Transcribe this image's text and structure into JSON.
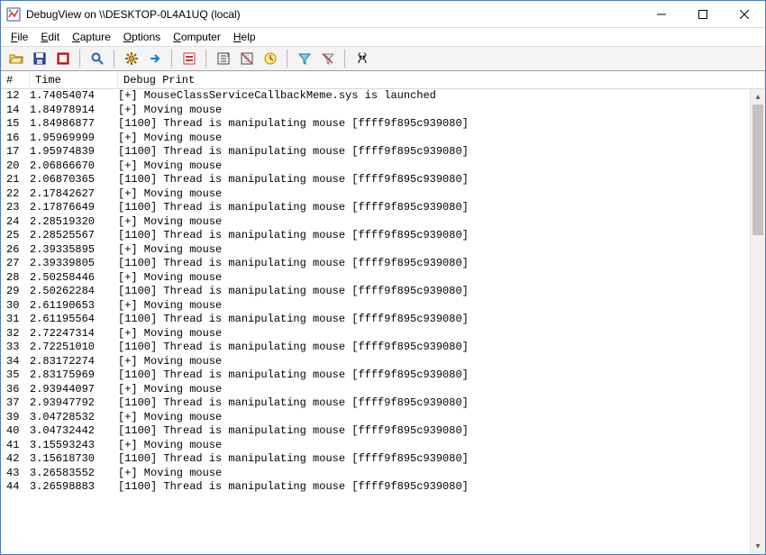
{
  "window": {
    "title": "DebugView on \\\\DESKTOP-0L4A1UQ (local)"
  },
  "menu": {
    "items": [
      {
        "label": "File",
        "mn": "F"
      },
      {
        "label": "Edit",
        "mn": "E"
      },
      {
        "label": "Capture",
        "mn": "C"
      },
      {
        "label": "Options",
        "mn": "O"
      },
      {
        "label": "Computer",
        "mn": "C"
      },
      {
        "label": "Help",
        "mn": "H"
      }
    ]
  },
  "toolbar": {
    "buttons": [
      {
        "name": "open-icon"
      },
      {
        "name": "save-icon"
      },
      {
        "name": "capture-toggle-icon"
      },
      {
        "sep": true
      },
      {
        "name": "magnifier-icon"
      },
      {
        "sep": true
      },
      {
        "name": "gear-icon"
      },
      {
        "name": "arrow-right-icon"
      },
      {
        "sep": true
      },
      {
        "name": "highlight-icon"
      },
      {
        "sep": true
      },
      {
        "name": "autoscroll-icon"
      },
      {
        "name": "clear-icon"
      },
      {
        "name": "clock-icon"
      },
      {
        "sep": true
      },
      {
        "name": "filter-include-icon"
      },
      {
        "name": "filter-exclude-icon"
      },
      {
        "sep": true
      },
      {
        "name": "find-icon"
      }
    ]
  },
  "columns": {
    "num": "#",
    "time": "Time",
    "msg": "Debug Print"
  },
  "rows": [
    {
      "n": "12",
      "t": "1.74054074",
      "m": "[+] MouseClassServiceCallbackMeme.sys is launched"
    },
    {
      "n": "14",
      "t": "1.84978914",
      "m": "[+] Moving mouse"
    },
    {
      "n": "15",
      "t": "1.84986877",
      "m": "[1100] Thread is manipulating mouse [ffff9f895c939080]"
    },
    {
      "n": "16",
      "t": "1.95969999",
      "m": "[+] Moving mouse"
    },
    {
      "n": "17",
      "t": "1.95974839",
      "m": "[1100] Thread is manipulating mouse [ffff9f895c939080]"
    },
    {
      "n": "20",
      "t": "2.06866670",
      "m": "[+] Moving mouse"
    },
    {
      "n": "21",
      "t": "2.06870365",
      "m": "[1100] Thread is manipulating mouse [ffff9f895c939080]"
    },
    {
      "n": "22",
      "t": "2.17842627",
      "m": "[+] Moving mouse"
    },
    {
      "n": "23",
      "t": "2.17876649",
      "m": "[1100] Thread is manipulating mouse [ffff9f895c939080]"
    },
    {
      "n": "24",
      "t": "2.28519320",
      "m": "[+] Moving mouse"
    },
    {
      "n": "25",
      "t": "2.28525567",
      "m": "[1100] Thread is manipulating mouse [ffff9f895c939080]"
    },
    {
      "n": "26",
      "t": "2.39335895",
      "m": "[+] Moving mouse"
    },
    {
      "n": "27",
      "t": "2.39339805",
      "m": "[1100] Thread is manipulating mouse [ffff9f895c939080]"
    },
    {
      "n": "28",
      "t": "2.50258446",
      "m": "[+] Moving mouse"
    },
    {
      "n": "29",
      "t": "2.50262284",
      "m": "[1100] Thread is manipulating mouse [ffff9f895c939080]"
    },
    {
      "n": "30",
      "t": "2.61190653",
      "m": "[+] Moving mouse"
    },
    {
      "n": "31",
      "t": "2.61195564",
      "m": "[1100] Thread is manipulating mouse [ffff9f895c939080]"
    },
    {
      "n": "32",
      "t": "2.72247314",
      "m": "[+] Moving mouse"
    },
    {
      "n": "33",
      "t": "2.72251010",
      "m": "[1100] Thread is manipulating mouse [ffff9f895c939080]"
    },
    {
      "n": "34",
      "t": "2.83172274",
      "m": "[+] Moving mouse"
    },
    {
      "n": "35",
      "t": "2.83175969",
      "m": "[1100] Thread is manipulating mouse [ffff9f895c939080]"
    },
    {
      "n": "36",
      "t": "2.93944097",
      "m": "[+] Moving mouse"
    },
    {
      "n": "37",
      "t": "2.93947792",
      "m": "[1100] Thread is manipulating mouse [ffff9f895c939080]"
    },
    {
      "n": "39",
      "t": "3.04728532",
      "m": "[+] Moving mouse"
    },
    {
      "n": "40",
      "t": "3.04732442",
      "m": "[1100] Thread is manipulating mouse [ffff9f895c939080]"
    },
    {
      "n": "41",
      "t": "3.15593243",
      "m": "[+] Moving mouse"
    },
    {
      "n": "42",
      "t": "3.15618730",
      "m": "[1100] Thread is manipulating mouse [ffff9f895c939080]"
    },
    {
      "n": "43",
      "t": "3.26583552",
      "m": "[+] Moving mouse"
    },
    {
      "n": "44",
      "t": "3.26598883",
      "m": "[1100] Thread is manipulating mouse [ffff9f895c939080]"
    }
  ]
}
